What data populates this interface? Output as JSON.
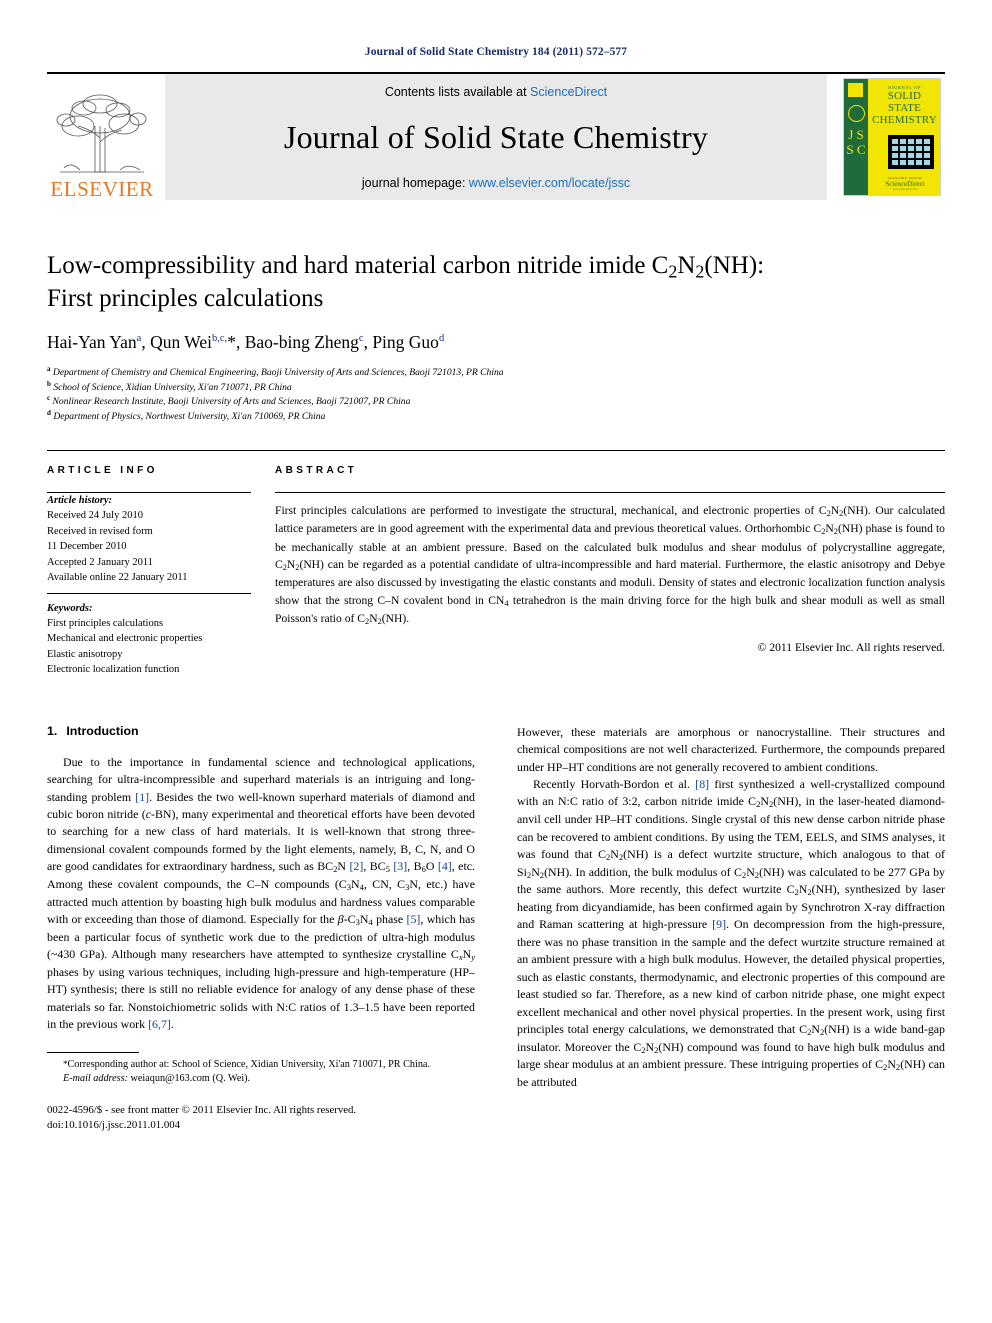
{
  "running_head": "Journal of Solid State Chemistry 184 (2011) 572–577",
  "masthead": {
    "contents_prefix": "Contents lists available at ",
    "sciencedirect": "ScienceDirect",
    "journal_name": "Journal of Solid State Chemistry",
    "homepage_prefix": "journal homepage: ",
    "homepage_url": "www.elsevier.com/locate/jssc",
    "publisher_word": "ELSEVIER",
    "publisher_color": "#E87722",
    "link_color": "#1a6fbd",
    "band_color": "#e9e9e9"
  },
  "cover": {
    "spine_letters": "J S S C",
    "kicker": "JOURNAL OF",
    "line1": "SOLID STATE",
    "line2": "CHEMISTRY",
    "foot_kicker": "AVAILABLE ONLINE",
    "foot_brand": "ScienceDirect",
    "foot_small": "www.sciencedirect.com",
    "yellow": "#F2E600",
    "green": "#1f6b3b"
  },
  "article": {
    "title_line1": "Low-compressibility and hard material carbon nitride imide C2N2(NH):",
    "title_line2": "First principles calculations",
    "authors_plain": "Hai-Yan Yan a, Qun Wei b,c,*, Bao-bing Zheng c, Ping Guo d",
    "authors": [
      {
        "name": "Hai-Yan Yan",
        "mark": "a",
        "sep": ", "
      },
      {
        "name": "Qun Wei",
        "mark": "b,c,*",
        "sep": ", "
      },
      {
        "name": "Bao-bing Zheng",
        "mark": "c",
        "sep": ", "
      },
      {
        "name": "Ping Guo",
        "mark": "d",
        "sep": ""
      }
    ],
    "affiliations": [
      {
        "mark": "a",
        "text": "Department of Chemistry and Chemical Engineering, Baoji University of Arts and Sciences, Baoji 721013, PR China"
      },
      {
        "mark": "b",
        "text": "School of Science, Xidian University, Xi'an 710071, PR China"
      },
      {
        "mark": "c",
        "text": "Nonlinear Research Institute, Baoji University of Arts and Sciences, Baoji 721007, PR China"
      },
      {
        "mark": "d",
        "text": "Department of Physics, Northwest University, Xi'an 710069, PR China"
      }
    ]
  },
  "info": {
    "heading": "ARTICLE INFO",
    "history_label": "Article history:",
    "history": [
      "Received 24 July 2010",
      "Received in revised form",
      "11 December 2010",
      "Accepted 2 January 2011",
      "Available online 22 January 2011"
    ],
    "keywords_label": "Keywords:",
    "keywords": [
      "First principles calculations",
      "Mechanical and electronic properties",
      "Elastic anisotropy",
      "Electronic localization function"
    ]
  },
  "abstract": {
    "heading": "ABSTRACT",
    "text": "First principles calculations are performed to investigate the structural, mechanical, and electronic properties of C2N2(NH). Our calculated lattice parameters are in good agreement with the experimental data and previous theoretical values. Orthorhombic C2N2(NH) phase is found to be mechanically stable at an ambient pressure. Based on the calculated bulk modulus and shear modulus of polycrystalline aggregate, C2N2(NH) can be regarded as a potential candidate of ultra-incompressible and hard material. Furthermore, the elastic anisotropy and Debye temperatures are also discussed by investigating the elastic constants and moduli. Density of states and electronic localization function analysis show that the strong C–N covalent bond in CN4 tetrahedron is the main driving force for the high bulk and shear moduli as well as small Poisson's ratio of C2N2(NH).",
    "copyright": "© 2011 Elsevier Inc. All rights reserved."
  },
  "introduction": {
    "number": "1.",
    "title": "Introduction",
    "para1": "Due to the importance in fundamental science and technological applications, searching for ultra-incompressible and superhard materials is an intriguing and long-standing problem [1]. Besides the two well-known superhard materials of diamond and cubic boron nitride (c-BN), many experimental and theoretical efforts have been devoted to searching for a new class of hard materials. It is well-known that strong three-dimensional covalent compounds formed by the light elements, namely, B, C, N, and O are good candidates for extraordinary hardness, such as BC2N [2], BC5 [3], B6O [4], etc. Among these covalent compounds, the C–N compounds (C3N4, CN, C3N, etc.) have attracted much attention by boasting high bulk modulus and hardness values comparable with or exceeding than those of diamond. Especially for the β-C3N4 phase [5], which has been a particular focus of synthetic work due to the prediction of ultra-high modulus (~430 GPa). Although many researchers have attempted to synthesize crystalline CxNy phases by using various techniques, including high-pressure and high-temperature (HP–HT) synthesis; there is still no reliable evidence for analogy of any dense phase of these materials so far. Nonstoichiometric solids with N:C ratios of 1.3–1.5 have been reported in the previous work [6,7].",
    "para2": "However, these materials are amorphous or nanocrystalline. Their structures and chemical compositions are not well characterized. Furthermore, the compounds prepared under HP–HT conditions are not generally recovered to ambient conditions.",
    "para3": "Recently Horvath-Bordon et al. [8] first synthesized a well-crystallized compound with an N:C ratio of 3:2, carbon nitride imide C2N2(NH), in the laser-heated diamond-anvil cell under HP–HT conditions. Single crystal of this new dense carbon nitride phase can be recovered to ambient conditions. By using the TEM, EELS, and SIMS analyses, it was found that C2N2(NH) is a defect wurtzite structure, which analogous to that of Si2N2(NH). In addition, the bulk modulus of C2N2(NH) was calculated to be 277 GPa by the same authors. More recently, this defect wurtzite C2N2(NH), synthesized by laser heating from dicyandiamide, has been confirmed again by Synchrotron X-ray diffraction and Raman scattering at high-pressure [9]. On decompression from the high-pressure, there was no phase transition in the sample and the defect wurtzite structure remained at an ambient pressure with a high bulk modulus. However, the detailed physical properties, such as elastic constants, thermodynamic, and electronic properties of this compound are least studied so far. Therefore, as a new kind of carbon nitride phase, one might expect excellent mechanical and other novel physical properties. In the present work, using first principles total energy calculations, we demonstrated that C2N2(NH) is a wide band-gap insulator. Moreover the C2N2(NH) compound was found to have high bulk modulus and large shear modulus at an ambient pressure. These intriguing properties of C2N2(NH) can be attributed"
  },
  "footnote": {
    "star": "*",
    "corresponding": "Corresponding author at: School of Science, Xidian University, Xi'an 710071, PR China.",
    "email_label": "E-mail address:",
    "email": "weiaqun@163.com (Q. Wei).",
    "issn_line": "0022-4596/$ - see front matter © 2011 Elsevier Inc. All rights reserved.",
    "doi_line": "doi:10.1016/j.jssc.2011.01.004"
  }
}
